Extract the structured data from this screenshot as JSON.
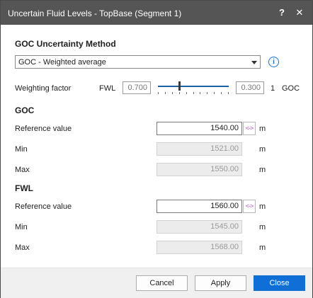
{
  "window": {
    "title": "Uncertain Fluid Levels - TopBase (Segment 1)",
    "help_glyph": "?",
    "close_glyph": "✕"
  },
  "method": {
    "heading": "GOC Uncertainty Method",
    "selected": "GOC - Weighted average",
    "info_glyph": "i"
  },
  "weighting": {
    "label": "Weighting factor",
    "left_label": "FWL",
    "left_value": "0.700",
    "right_value": "0.300",
    "right_count": "1",
    "right_label": "GOC",
    "slider_fraction": 0.3
  },
  "goc": {
    "heading": "GOC",
    "reference_label": "Reference value",
    "reference_value": "1540.00",
    "min_label": "Min",
    "min_value": "1521.00",
    "max_label": "Max",
    "max_value": "1550.00",
    "unit": "m"
  },
  "fwl": {
    "heading": "FWL",
    "reference_label": "Reference value",
    "reference_value": "1560.00",
    "min_label": "Min",
    "min_value": "1545.00",
    "max_label": "Max",
    "max_value": "1568.00",
    "unit": "m"
  },
  "swap_glyph": "<->",
  "buttons": {
    "cancel": "Cancel",
    "apply": "Apply",
    "close": "Close"
  },
  "colors": {
    "titlebar": "#555555",
    "accent": "#0f6fd6",
    "swap": "#b04fc4"
  }
}
